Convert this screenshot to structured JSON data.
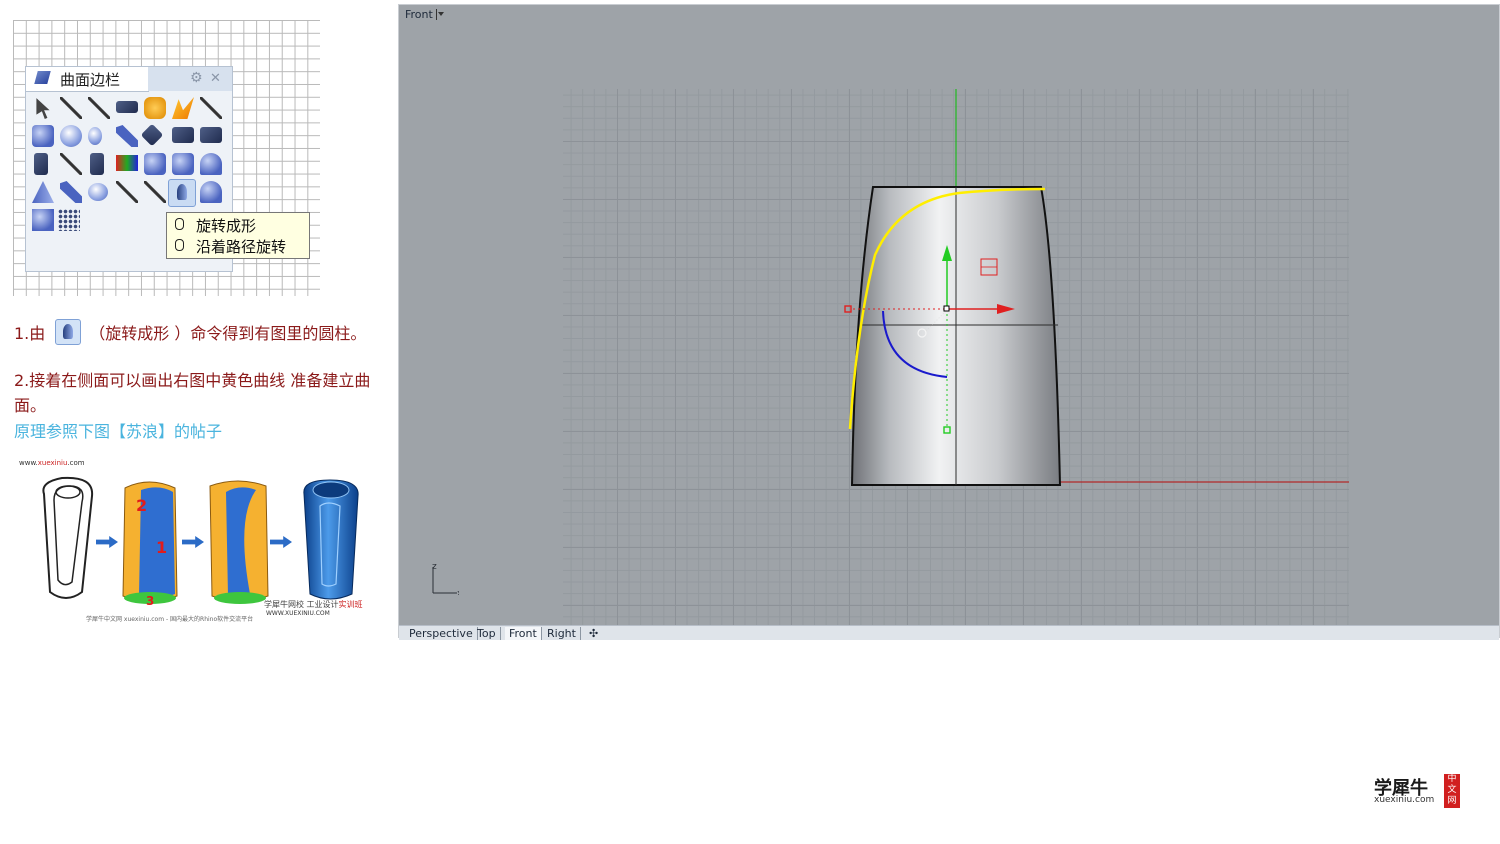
{
  "toolbar_panel": {
    "title": "曲面边栏",
    "tooltip": {
      "items": [
        "旋转成形",
        "沿着路径旋转"
      ]
    }
  },
  "instructions": {
    "step1_prefix": "1.由",
    "step1_suffix": "（旋转成形 ）命令得到有图里的圆柱。",
    "step2": "2.接着在侧面可以画出右图中黄色曲线 准备建立曲面。",
    "step3": "原理参照下图【苏浪】的帖子"
  },
  "reference_image": {
    "url_prefix": "www.",
    "url_highlight": "xuexiniu",
    "url_suffix": ".com",
    "numbers": [
      "2",
      "1",
      "3"
    ],
    "brand_prefix": "学犀牛网校 工业设计",
    "brand_highlight": "实训班",
    "brand_url": "WWW.XUEXINIU.COM",
    "footer": "学犀牛中文网 xuexiniu.com - 国内最大的Rhino软件交流平台"
  },
  "viewport": {
    "title": "Front",
    "tabs": [
      "Perspective",
      "Top",
      "Front",
      "Right"
    ],
    "active_tab": "Front",
    "axis_labels": {
      "z": "z",
      "x": "x"
    }
  },
  "logo": {
    "cn": "学犀牛",
    "en": "xuexiniu.com",
    "badge": [
      "中",
      "文",
      "网"
    ]
  },
  "colors": {
    "instruction_red": "#8b1a1a",
    "instruction_blue": "#4ab4de",
    "curve_yellow": "#ffee00",
    "arc_blue": "#1a1acc",
    "gumball_green": "#22cc22",
    "gumball_red": "#e02020",
    "viewport_bg": "#9ea3a8"
  }
}
